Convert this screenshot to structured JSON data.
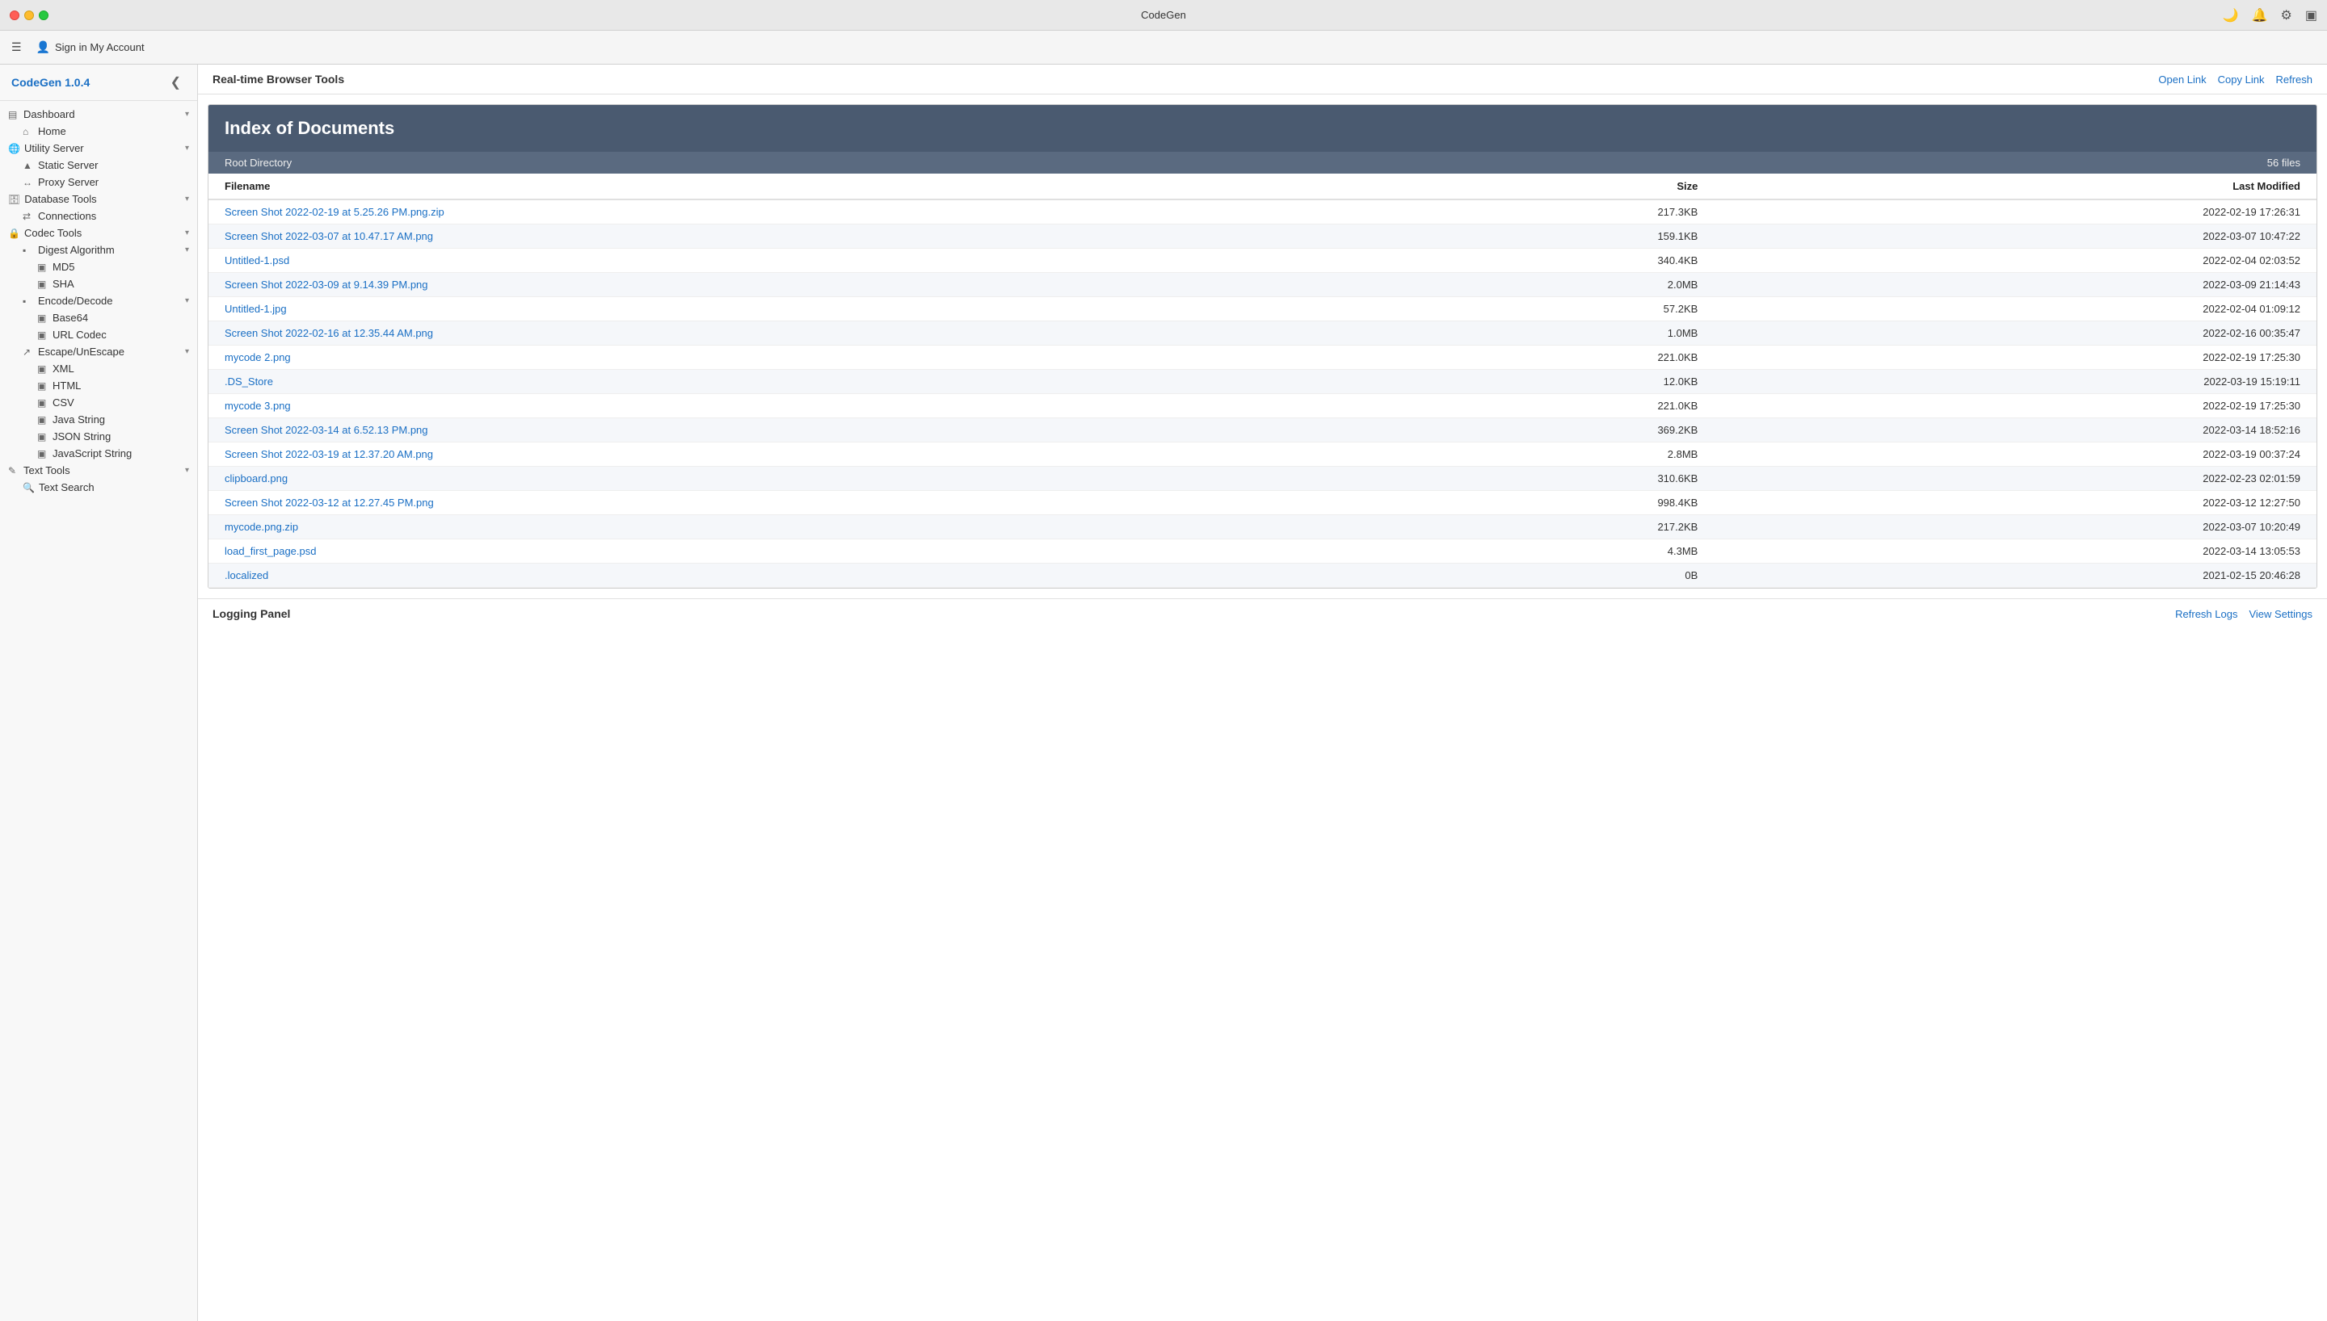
{
  "app": {
    "title": "CodeGen",
    "version": "CodeGen 1.0.4"
  },
  "titlebar": {
    "title": "CodeGen",
    "buttons": {
      "moon": "🌙",
      "bell": "🔔",
      "gear": "⚙",
      "sidebar": "▣"
    }
  },
  "toolbar": {
    "sign_in_label": "Sign in My Account"
  },
  "sidebar": {
    "title": "CodeGen 1.0.4",
    "items": [
      {
        "id": "dashboard",
        "label": "Dashboard",
        "level": 0,
        "icon": "▤",
        "chevron": "▾",
        "expanded": true
      },
      {
        "id": "home",
        "label": "Home",
        "level": 1,
        "icon": "⌂"
      },
      {
        "id": "utility-server",
        "label": "Utility Server",
        "level": 0,
        "icon": "🌐",
        "chevron": "▾",
        "expanded": true
      },
      {
        "id": "static-server",
        "label": "Static Server",
        "level": 1,
        "icon": "▲"
      },
      {
        "id": "proxy-server",
        "label": "Proxy Server",
        "level": 1,
        "icon": "↔"
      },
      {
        "id": "database-tools",
        "label": "Database Tools",
        "level": 0,
        "icon": "🗄",
        "chevron": "▾",
        "expanded": true
      },
      {
        "id": "connections",
        "label": "Connections",
        "level": 1,
        "icon": "⇄"
      },
      {
        "id": "codec-tools",
        "label": "Codec Tools",
        "level": 0,
        "icon": "🔒",
        "chevron": "▾",
        "expanded": true
      },
      {
        "id": "digest-algorithm",
        "label": "Digest Algorithm",
        "level": 1,
        "icon": "▪",
        "chevron": "▾",
        "expanded": true
      },
      {
        "id": "md5",
        "label": "MD5",
        "level": 2,
        "icon": "▣"
      },
      {
        "id": "sha",
        "label": "SHA",
        "level": 2,
        "icon": "▣"
      },
      {
        "id": "encode-decode",
        "label": "Encode/Decode",
        "level": 1,
        "icon": "▪",
        "chevron": "▾",
        "expanded": true
      },
      {
        "id": "base64",
        "label": "Base64",
        "level": 2,
        "icon": "▣"
      },
      {
        "id": "url-codec",
        "label": "URL Codec",
        "level": 2,
        "icon": "▣"
      },
      {
        "id": "escape-unescape",
        "label": "Escape/UnEscape",
        "level": 1,
        "icon": "↗",
        "chevron": "▾",
        "expanded": true
      },
      {
        "id": "xml",
        "label": "XML",
        "level": 2,
        "icon": "▣"
      },
      {
        "id": "html",
        "label": "HTML",
        "level": 2,
        "icon": "▣"
      },
      {
        "id": "csv",
        "label": "CSV",
        "level": 2,
        "icon": "▣"
      },
      {
        "id": "java-string",
        "label": "Java String",
        "level": 2,
        "icon": "▣"
      },
      {
        "id": "json-string",
        "label": "JSON String",
        "level": 2,
        "icon": "▣"
      },
      {
        "id": "javascript-string",
        "label": "JavaScript String",
        "level": 2,
        "icon": "▣"
      },
      {
        "id": "text-tools",
        "label": "Text Tools",
        "level": 0,
        "icon": "✎",
        "chevron": "▾",
        "expanded": true
      },
      {
        "id": "text-search",
        "label": "Text Search",
        "level": 1,
        "icon": "🔍"
      }
    ]
  },
  "content": {
    "header_title": "Real-time Browser Tools",
    "actions": {
      "open_link": "Open Link",
      "copy_link": "Copy Link",
      "refresh": "Refresh"
    }
  },
  "file_browser": {
    "title": "Index of Documents",
    "subtitle": "Root Directory",
    "file_count": "56 files",
    "columns": {
      "filename": "Filename",
      "size": "Size",
      "last_modified": "Last Modified"
    },
    "files": [
      {
        "name": "Screen Shot 2022-02-19 at 5.25.26 PM.png.zip",
        "size": "217.3KB",
        "modified": "2022-02-19 17:26:31"
      },
      {
        "name": "Screen Shot 2022-03-07 at 10.47.17 AM.png",
        "size": "159.1KB",
        "modified": "2022-03-07 10:47:22"
      },
      {
        "name": "Untitled-1.psd",
        "size": "340.4KB",
        "modified": "2022-02-04 02:03:52"
      },
      {
        "name": "Screen Shot 2022-03-09 at 9.14.39 PM.png",
        "size": "2.0MB",
        "modified": "2022-03-09 21:14:43"
      },
      {
        "name": "Untitled-1.jpg",
        "size": "57.2KB",
        "modified": "2022-02-04 01:09:12"
      },
      {
        "name": "Screen Shot 2022-02-16 at 12.35.44 AM.png",
        "size": "1.0MB",
        "modified": "2022-02-16 00:35:47"
      },
      {
        "name": "mycode 2.png",
        "size": "221.0KB",
        "modified": "2022-02-19 17:25:30"
      },
      {
        "name": ".DS_Store",
        "size": "12.0KB",
        "modified": "2022-03-19 15:19:11"
      },
      {
        "name": "mycode 3.png",
        "size": "221.0KB",
        "modified": "2022-02-19 17:25:30"
      },
      {
        "name": "Screen Shot 2022-03-14 at 6.52.13 PM.png",
        "size": "369.2KB",
        "modified": "2022-03-14 18:52:16"
      },
      {
        "name": "Screen Shot 2022-03-19 at 12.37.20 AM.png",
        "size": "2.8MB",
        "modified": "2022-03-19 00:37:24"
      },
      {
        "name": "clipboard.png",
        "size": "310.6KB",
        "modified": "2022-02-23 02:01:59"
      },
      {
        "name": "Screen Shot 2022-03-12 at 12.27.45 PM.png",
        "size": "998.4KB",
        "modified": "2022-03-12 12:27:50"
      },
      {
        "name": "mycode.png.zip",
        "size": "217.2KB",
        "modified": "2022-03-07 10:20:49"
      },
      {
        "name": "load_first_page.psd",
        "size": "4.3MB",
        "modified": "2022-03-14 13:05:53"
      },
      {
        "name": ".localized",
        "size": "0B",
        "modified": "2021-02-15 20:46:28"
      }
    ]
  },
  "logging_panel": {
    "title": "Logging Panel",
    "actions": {
      "refresh_logs": "Refresh Logs",
      "view_settings": "View Settings"
    }
  }
}
